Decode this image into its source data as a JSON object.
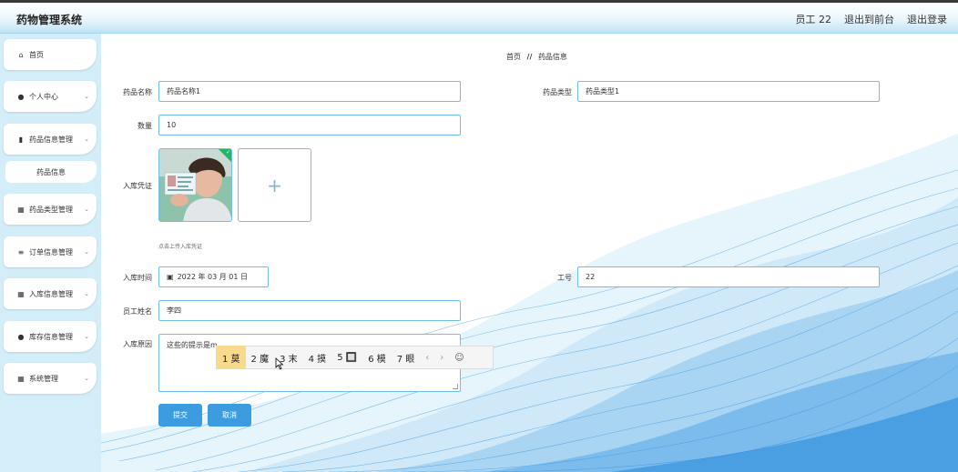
{
  "app": {
    "title": "药物管理系统"
  },
  "header": {
    "user": "员工 22",
    "front": "退出到前台",
    "logout": "退出登录"
  },
  "sidebar": {
    "items": [
      {
        "label": "首页",
        "icon": "home-icon",
        "glyph": "⌂"
      },
      {
        "label": "个人中心",
        "icon": "user-icon",
        "glyph": "●"
      },
      {
        "label": "药品信息管理",
        "icon": "book-icon",
        "glyph": "▮"
      },
      {
        "label": "药品信息",
        "icon": "",
        "glyph": ""
      },
      {
        "label": "药品类型管理",
        "icon": "grid-icon",
        "glyph": "▦"
      },
      {
        "label": "订单信息管理",
        "icon": "list-icon",
        "glyph": "≡"
      },
      {
        "label": "入库信息管理",
        "icon": "table-icon",
        "glyph": "▦"
      },
      {
        "label": "库存信息管理",
        "icon": "user-icon",
        "glyph": "●"
      },
      {
        "label": "系统管理",
        "icon": "grid-icon",
        "glyph": "▦"
      }
    ],
    "arrow": "⌄"
  },
  "breadcrumb": {
    "home": "首页",
    "sep": "//",
    "current": "药品信息"
  },
  "form": {
    "name_label": "药品名称",
    "name_value": "药品名称1",
    "type_label": "药品类型",
    "type_value": "药品类型1",
    "qty_label": "数量",
    "qty_value": "10",
    "voucher_label": "入库凭证",
    "voucher_hint": "点击上传入库凭证",
    "add_glyph": "+",
    "time_label": "入库时间",
    "time_value": "2022 年 03 月 01 日",
    "empno_label": "工号",
    "empno_value": "22",
    "empname_label": "员工姓名",
    "empname_value": "李四",
    "reason_label": "入库原因",
    "reason_value": "这些的提示是m",
    "submit": "提交",
    "cancel": "取消"
  },
  "ime": {
    "candidates": [
      "1 莫",
      "2 魔",
      "3 末",
      "4 摸",
      "5 🔲",
      "6 模",
      "7 眼"
    ],
    "prev": "‹",
    "next": "›",
    "emoji": "☺"
  }
}
